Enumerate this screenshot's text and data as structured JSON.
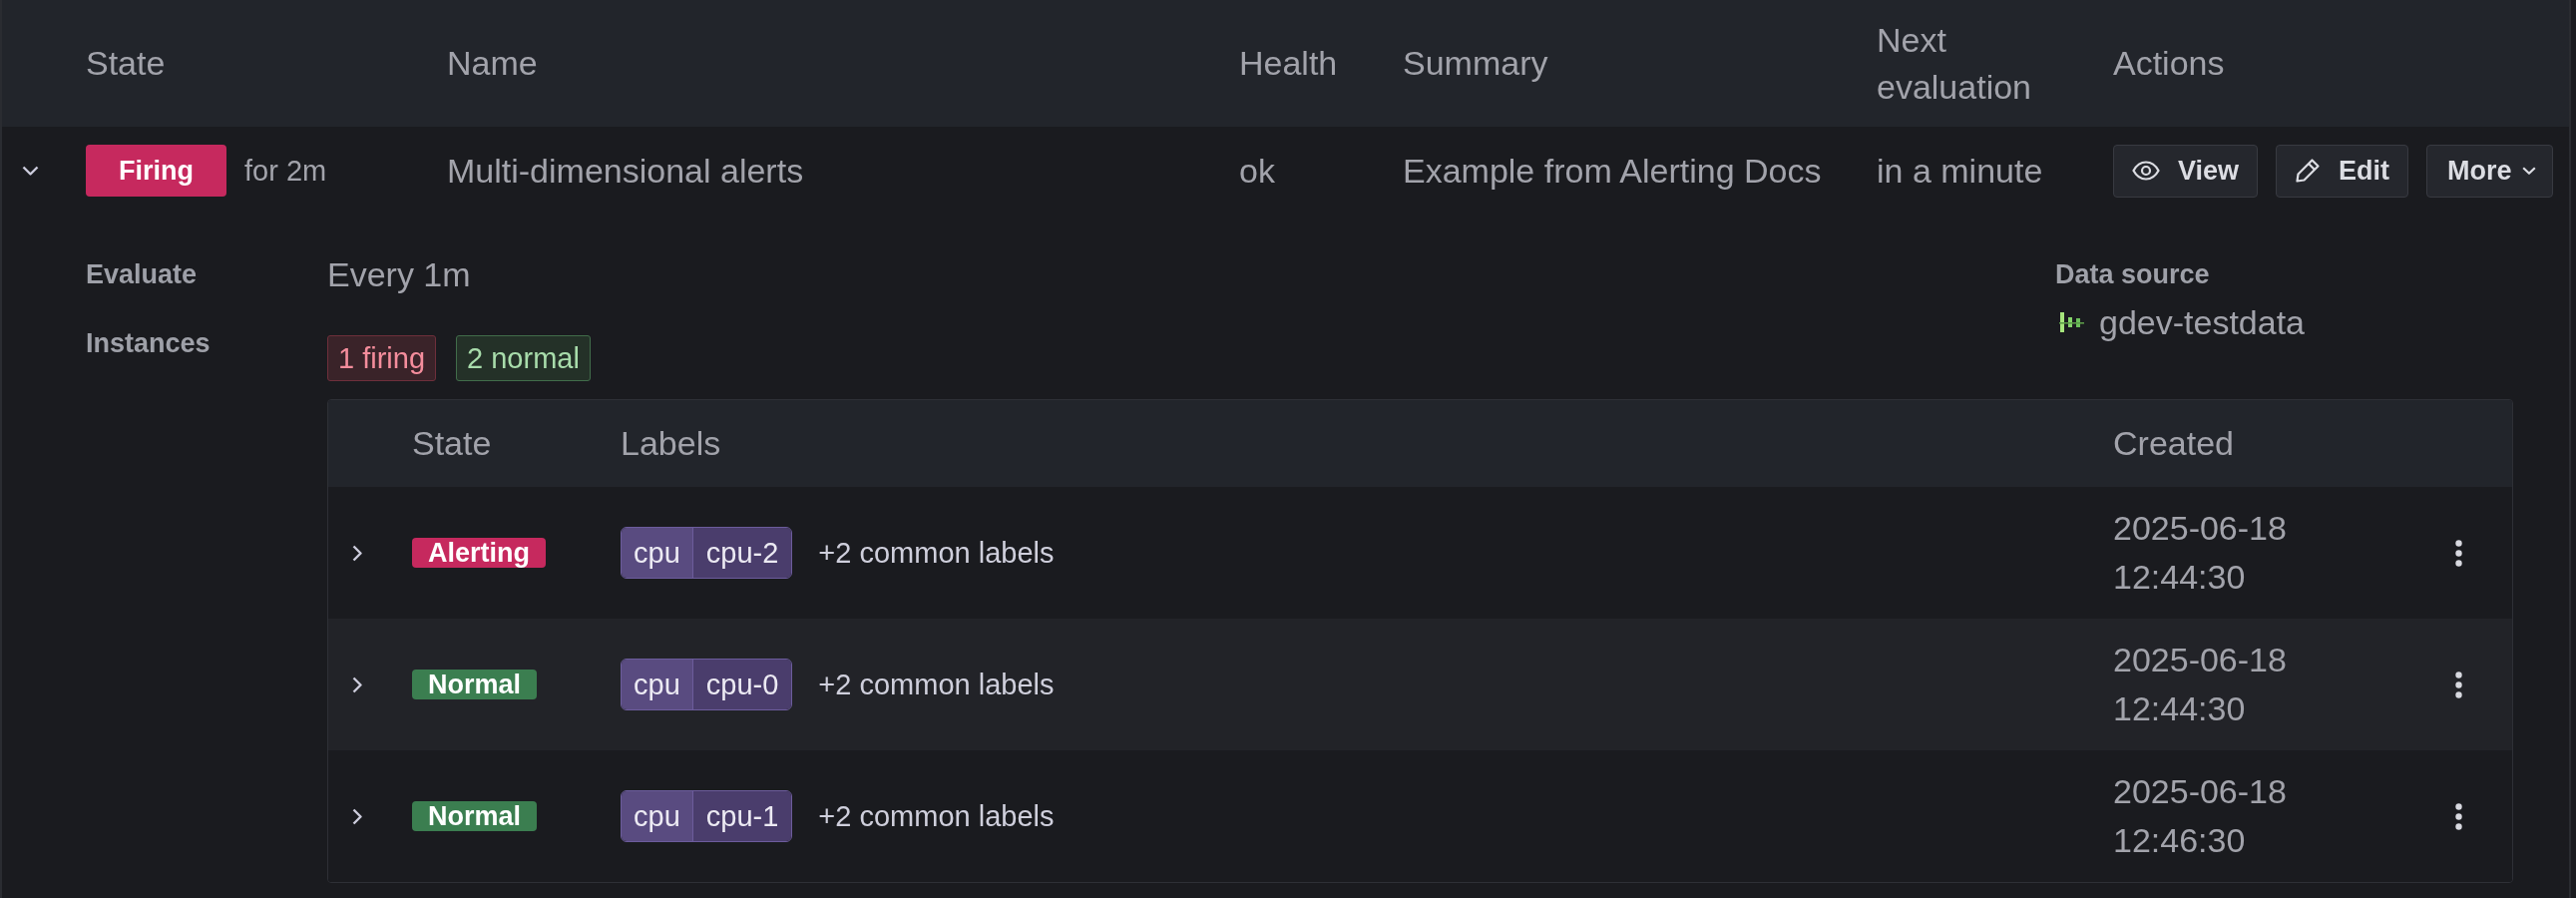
{
  "table": {
    "columns": [
      "State",
      "Name",
      "Health",
      "Summary",
      "Next evaluation",
      "Actions"
    ],
    "rows": [
      {
        "expanded": true,
        "state": {
          "label": "Firing",
          "kind": "firing"
        },
        "duration": "for 2m",
        "name": "Multi-dimensional alerts",
        "health": "ok",
        "summary": "Example from Alerting Docs",
        "next_evaluation": "in a minute",
        "actions": [
          {
            "label": "View",
            "kind": "view"
          },
          {
            "label": "Edit",
            "kind": "edit"
          },
          {
            "label": "More",
            "kind": "menu"
          }
        ],
        "details": {
          "evaluate": {
            "label": "Evaluate",
            "value": "Every 1m"
          },
          "data_source": {
            "label": "Data source",
            "value": "gdev-testdata"
          },
          "instances": {
            "label": "Instances",
            "counts": [
              {
                "label": "1 firing",
                "kind": "firing"
              },
              {
                "label": "2 normal",
                "kind": "normal"
              }
            ],
            "table": {
              "columns": [
                "State",
                "Labels",
                "Created"
              ],
              "rows": [
                {
                  "expanded": false,
                  "state": {
                    "label": "Alerting",
                    "kind": "firing"
                  },
                  "labels": [
                    {
                      "key": "cpu",
                      "value": "cpu-2"
                    }
                  ],
                  "common_labels": "+2 common labels",
                  "created": "2025-06-18 12:44:30"
                },
                {
                  "expanded": false,
                  "state": {
                    "label": "Normal",
                    "kind": "normal"
                  },
                  "labels": [
                    {
                      "key": "cpu",
                      "value": "cpu-0"
                    }
                  ],
                  "common_labels": "+2 common labels",
                  "created": "2025-06-18 12:44:30"
                },
                {
                  "expanded": false,
                  "state": {
                    "label": "Normal",
                    "kind": "normal"
                  },
                  "labels": [
                    {
                      "key": "cpu",
                      "value": "cpu-1"
                    }
                  ],
                  "common_labels": "+2 common labels",
                  "created": "2025-06-18 12:46:30"
                }
              ]
            }
          }
        }
      }
    ]
  }
}
